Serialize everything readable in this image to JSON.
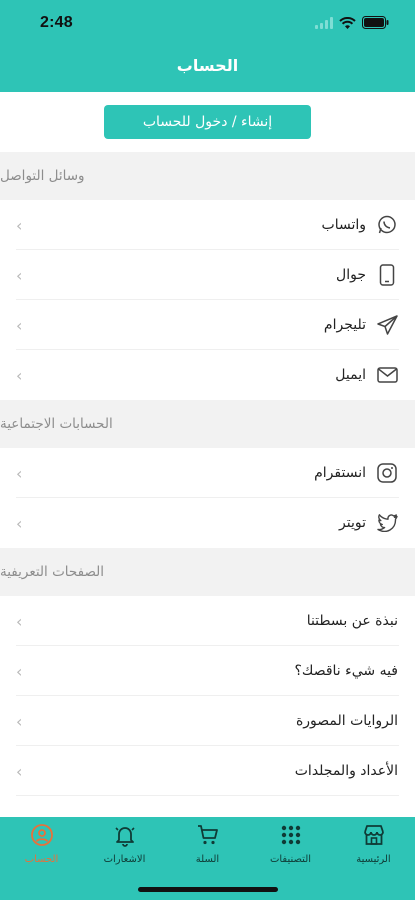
{
  "status": {
    "time": "2:48"
  },
  "header": {
    "title": "الحساب"
  },
  "login": {
    "label": "إنشاء / دخول للحساب"
  },
  "sections": [
    {
      "title": "وسائل التواصل",
      "items": [
        {
          "label": "واتساب",
          "icon": "whatsapp-icon"
        },
        {
          "label": "جوال",
          "icon": "phone-icon"
        },
        {
          "label": "تليجرام",
          "icon": "telegram-icon"
        },
        {
          "label": "ايميل",
          "icon": "email-icon"
        }
      ]
    },
    {
      "title": "الحسابات الاجتماعية",
      "items": [
        {
          "label": "انستقرام",
          "icon": "instagram-icon"
        },
        {
          "label": "تويتر",
          "icon": "twitter-icon"
        }
      ]
    },
    {
      "title": "الصفحات التعريفية",
      "items": [
        {
          "label": "نبذة عن بسطتنا"
        },
        {
          "label": "فيه شيء ناقصك؟"
        },
        {
          "label": "الروايات المصورة"
        },
        {
          "label": "الأعداد والمجلدات"
        }
      ]
    }
  ],
  "tabbar": {
    "home": "الرئيسية",
    "categories": "التصنيفات",
    "cart": "السلة",
    "notifications": "الاشعارات",
    "account": "الحساب"
  },
  "colors": {
    "brand": "#2ec4b6",
    "active_tab": "#e8713b"
  }
}
